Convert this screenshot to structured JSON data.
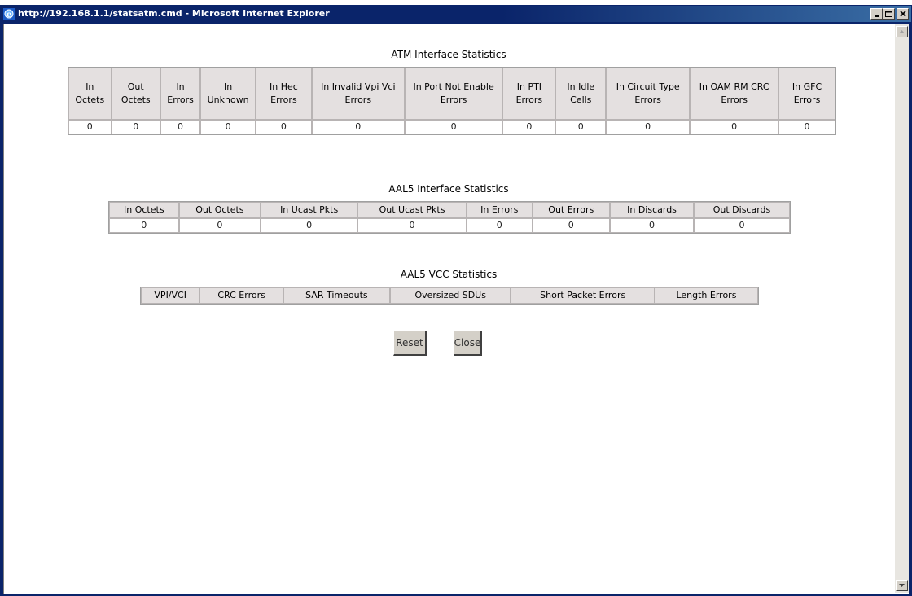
{
  "window": {
    "title": "http://192.168.1.1/statsatm.cmd - Microsoft Internet Explorer",
    "minimize_label": "_",
    "restore_label": "□",
    "close_label": "×"
  },
  "atm": {
    "title": "ATM Interface Statistics",
    "headers": [
      "In Octets",
      "Out Octets",
      "In Errors",
      "In Unknown",
      "In Hec Errors",
      "In Invalid Vpi Vci Errors",
      "In Port Not Enable Errors",
      "In PTI Errors",
      "In Idle Cells",
      "In Circuit Type Errors",
      "In OAM RM CRC Errors",
      "In GFC Errors"
    ],
    "values": [
      "0",
      "0",
      "0",
      "0",
      "0",
      "0",
      "0",
      "0",
      "0",
      "0",
      "0",
      "0"
    ]
  },
  "aal5": {
    "title": "AAL5 Interface Statistics",
    "headers": [
      "In Octets",
      "Out Octets",
      "In Ucast Pkts",
      "Out Ucast Pkts",
      "In Errors",
      "Out Errors",
      "In Discards",
      "Out Discards"
    ],
    "values": [
      "0",
      "0",
      "0",
      "0",
      "0",
      "0",
      "0",
      "0"
    ]
  },
  "vcc": {
    "title": "AAL5 VCC Statistics",
    "headers": [
      "VPI/VCI",
      "CRC Errors",
      "SAR Timeouts",
      "Oversized SDUs",
      "Short Packet Errors",
      "Length Errors"
    ]
  },
  "buttons": {
    "reset": "Reset",
    "close": "Close"
  }
}
